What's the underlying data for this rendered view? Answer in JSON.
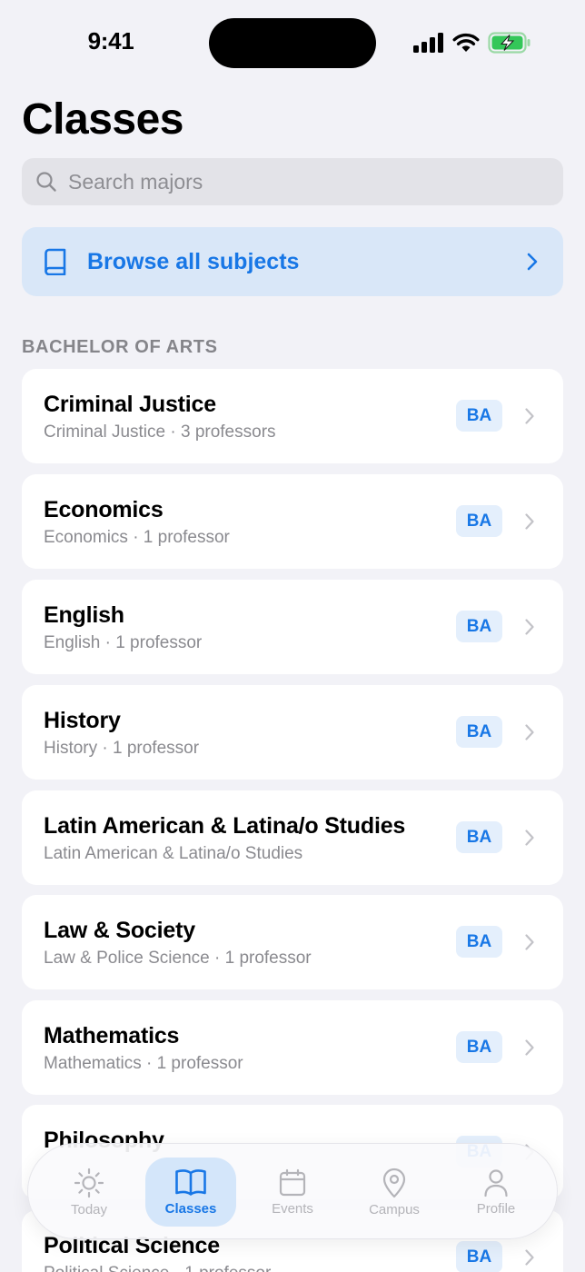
{
  "status_bar": {
    "time": "9:41"
  },
  "title": "Classes",
  "search": {
    "placeholder": "Search majors"
  },
  "browse": {
    "label": "Browse all subjects"
  },
  "section": {
    "header": "BACHELOR OF ARTS"
  },
  "majors": [
    {
      "title": "Criminal Justice",
      "subtitle": "Criminal Justice · 3 professors",
      "badge": "BA"
    },
    {
      "title": "Economics",
      "subtitle": "Economics · 1 professor",
      "badge": "BA"
    },
    {
      "title": "English",
      "subtitle": "English · 1 professor",
      "badge": "BA"
    },
    {
      "title": "History",
      "subtitle": "History · 1 professor",
      "badge": "BA"
    },
    {
      "title": "Latin American & Latina/o Studies",
      "subtitle": "Latin American & Latina/o Studies",
      "badge": "BA"
    },
    {
      "title": "Law & Society",
      "subtitle": "Law & Police Science · 1 professor",
      "badge": "BA"
    },
    {
      "title": "Mathematics",
      "subtitle": "Mathematics · 1 professor",
      "badge": "BA"
    },
    {
      "title": "Philosophy",
      "subtitle": "",
      "badge": "BA"
    },
    {
      "title": "Political Science",
      "subtitle": "Political Science · 1 professor",
      "badge": "BA"
    }
  ],
  "tabs": [
    {
      "label": "Today",
      "icon": "sun-icon",
      "active": false
    },
    {
      "label": "Classes",
      "icon": "book-icon",
      "active": true
    },
    {
      "label": "Events",
      "icon": "calendar-icon",
      "active": false
    },
    {
      "label": "Campus",
      "icon": "map-pin-icon",
      "active": false
    },
    {
      "label": "Profile",
      "icon": "person-icon",
      "active": false
    }
  ],
  "colors": {
    "accent": "#1877e6",
    "background": "#f2f2f7",
    "battery": "#34c759"
  }
}
